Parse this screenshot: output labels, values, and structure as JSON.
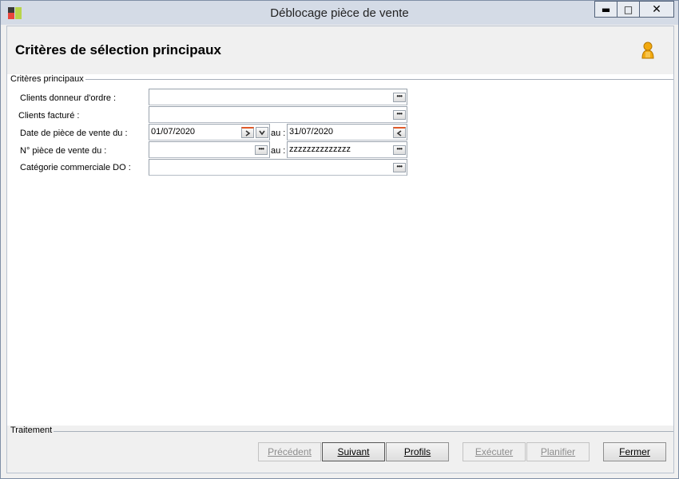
{
  "window": {
    "title": "Déblocage pièce de vente",
    "minimize_glyph": "▬",
    "maximize_glyph": "□",
    "close_glyph": "✕"
  },
  "header": {
    "title": "Critères de sélection principaux",
    "user_icon": "user-icon"
  },
  "criteria_group": {
    "caption": "Critères principaux",
    "rows": [
      {
        "label": "Clients donneur d'ordre :",
        "value": ""
      },
      {
        "label": "Clients facturé :",
        "value": ""
      },
      {
        "label": "Date de pièce de vente du :",
        "from": "01/07/2020",
        "to_label": "au :",
        "to": "31/07/2020"
      },
      {
        "label": "N° pièce de vente du :",
        "from": "",
        "to_label": "au :",
        "to": "zzzzzzzzzzzzzz"
      },
      {
        "label": "Catégorie commerciale DO :",
        "value": ""
      }
    ]
  },
  "treatment_group": {
    "caption": "Traitement"
  },
  "buttons": {
    "previous": "Précédent",
    "next": "Suivant",
    "profiles": "Profils",
    "execute": "Exécuter",
    "schedule": "Planifier",
    "close": "Fermer"
  },
  "colors": {
    "titlebar": "#d4dbe6",
    "accent_orange": "#f0a000"
  }
}
